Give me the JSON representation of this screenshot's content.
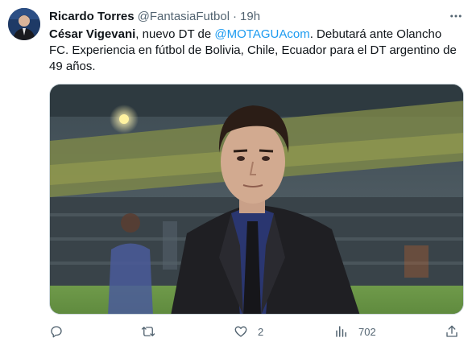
{
  "author": {
    "display_name": "Ricardo Torres",
    "handle": "@FantasiaFutbol",
    "separator": "·",
    "time": "19h"
  },
  "tweet": {
    "bold_name": "César Vigevani",
    "text_part1": ", nuevo DT de ",
    "mention": "@MOTAGUAcom",
    "text_part2": ". Debutará ante Olancho FC. Experiencia en fútbol de Bolivia, Chile, Ecuador para el DT argentino de 49 años."
  },
  "actions": {
    "reply_count": "",
    "retweet_count": "",
    "like_count": "2",
    "views_count": "702"
  },
  "icons": {
    "more": "more-icon",
    "reply": "reply-icon",
    "retweet": "retweet-icon",
    "like": "like-icon",
    "views": "views-icon",
    "share": "share-icon"
  },
  "colors": {
    "text": "#0f1419",
    "secondary": "#536471",
    "link": "#1d9bf0"
  }
}
